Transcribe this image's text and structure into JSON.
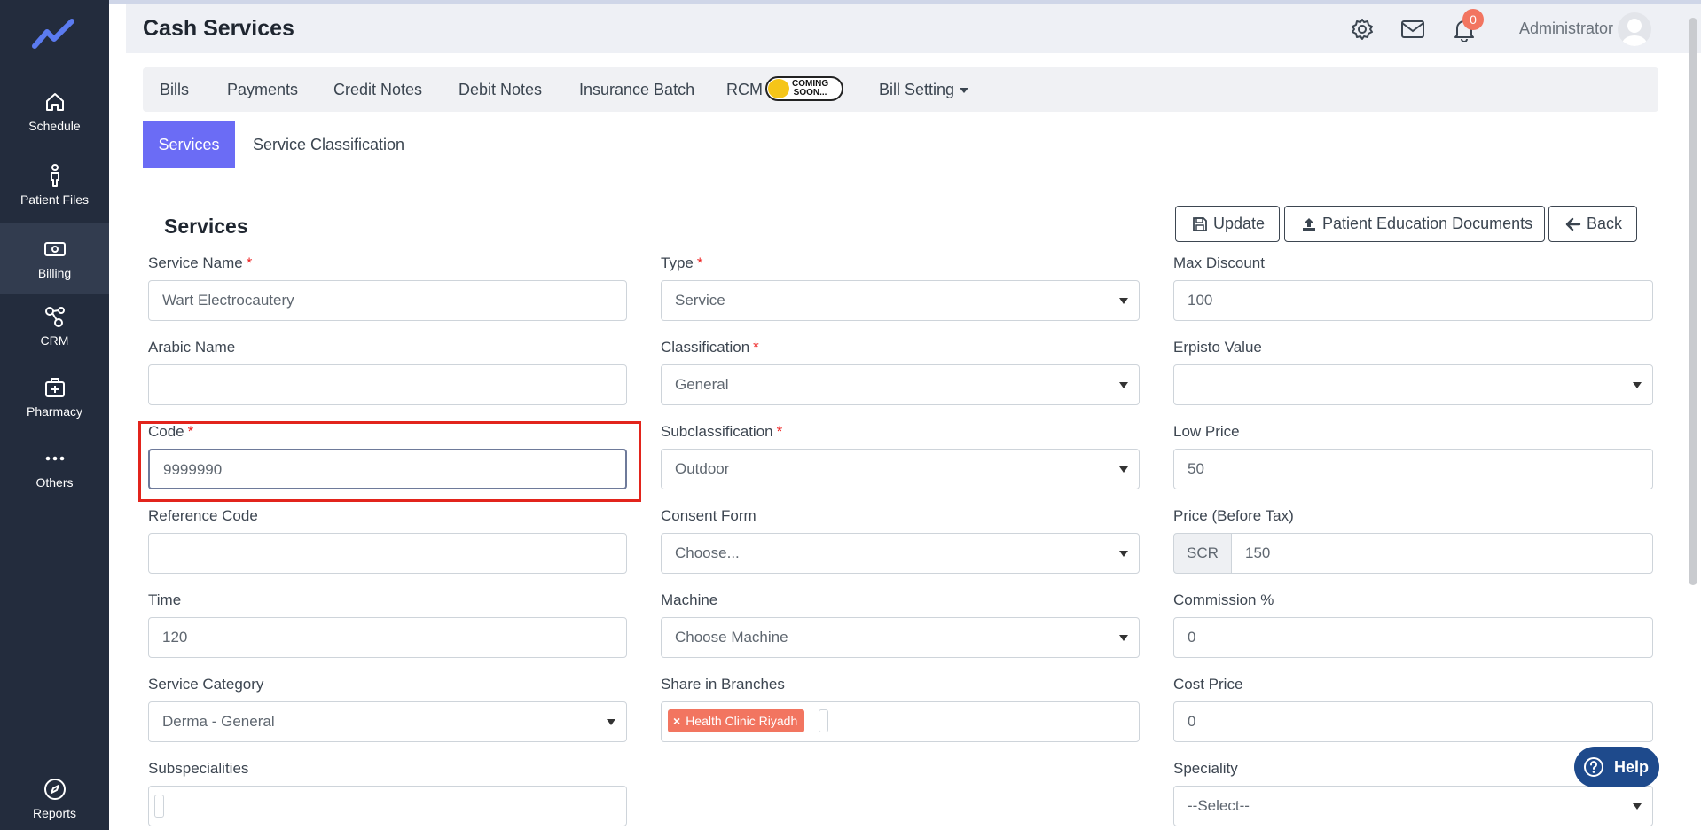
{
  "sidebar": {
    "items": [
      {
        "label": "Schedule",
        "icon": "home-icon"
      },
      {
        "label": "Patient Files",
        "icon": "person-icon"
      },
      {
        "label": "Billing",
        "icon": "money-icon",
        "active": true
      },
      {
        "label": "CRM",
        "icon": "network-icon"
      },
      {
        "label": "Pharmacy",
        "icon": "medical-kit-icon"
      },
      {
        "label": "Others",
        "icon": "more-dots-icon"
      }
    ],
    "reports": {
      "label": "Reports",
      "icon": "compass-icon"
    }
  },
  "header": {
    "title": "Cash Services",
    "notification_count": "0",
    "user_name": "Administrator"
  },
  "tabs": [
    {
      "label": "Bills"
    },
    {
      "label": "Payments"
    },
    {
      "label": "Credit Notes"
    },
    {
      "label": "Debit Notes"
    },
    {
      "label": "Insurance Batch"
    },
    {
      "label": "RCM"
    },
    {
      "label": "Bill Setting"
    }
  ],
  "coming_soon": {
    "line1": "COMING",
    "line2": "SOON..."
  },
  "subtabs": {
    "active": "Services",
    "other": "Service Classification"
  },
  "section": {
    "title": "Services"
  },
  "buttons": {
    "update": "Update",
    "patient_docs": "Patient Education Documents",
    "back": "Back"
  },
  "form": {
    "service_name": {
      "label": "Service Name",
      "value": "Wart Electrocautery"
    },
    "type": {
      "label": "Type",
      "value": "Service"
    },
    "max_discount": {
      "label": "Max Discount",
      "value": "100"
    },
    "arabic_name": {
      "label": "Arabic Name",
      "value": ""
    },
    "classification": {
      "label": "Classification",
      "value": "General"
    },
    "erpisto_value": {
      "label": "Erpisto Value",
      "value": ""
    },
    "code": {
      "label": "Code",
      "value": "9999990"
    },
    "subclassification": {
      "label": "Subclassification",
      "value": "Outdoor"
    },
    "low_price": {
      "label": "Low Price",
      "value": "50"
    },
    "reference_code": {
      "label": "Reference Code",
      "value": ""
    },
    "consent_form": {
      "label": "Consent Form",
      "value": "Choose..."
    },
    "price_before_tax": {
      "label": "Price (Before Tax)",
      "currency": "SCR",
      "value": "150"
    },
    "time": {
      "label": "Time",
      "value": "120"
    },
    "machine": {
      "label": "Machine",
      "value": "Choose Machine"
    },
    "commission": {
      "label": "Commission %",
      "value": "0"
    },
    "service_category": {
      "label": "Service Category",
      "value": "Derma - General"
    },
    "share_in_branches": {
      "label": "Share in Branches",
      "tags": [
        "Health Clinic Riyadh"
      ]
    },
    "cost_price": {
      "label": "Cost Price",
      "value": "0"
    },
    "subspecialities": {
      "label": "Subspecialities",
      "value": ""
    },
    "speciality": {
      "label": "Speciality",
      "value": "--Select--"
    }
  },
  "help": {
    "label": "Help"
  },
  "colors": {
    "sidebar": "#232c3d",
    "accent": "#6b6cf5",
    "badge": "#f27560",
    "highlight": "#e2241c",
    "help": "#1e4a8c"
  }
}
